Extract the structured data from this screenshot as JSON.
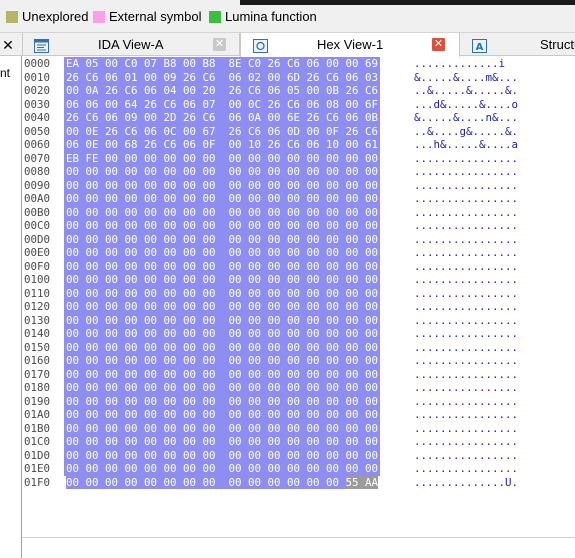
{
  "legend": [
    {
      "label": "Unexplored",
      "color": "#b5b569"
    },
    {
      "label": "External symbol",
      "color": "#ff9ee8"
    },
    {
      "label": "Lumina function",
      "color": "#3cc03c"
    }
  ],
  "left_panel": {
    "fragment": "nt",
    "close_glyph": "✕"
  },
  "tabs": [
    {
      "label": "IDA View-A",
      "active": false,
      "icon": "ida-view-icon",
      "close": "✕"
    },
    {
      "label": "Hex View-1",
      "active": true,
      "icon": "hex-view-icon",
      "close": "✕"
    },
    {
      "label": "Structu",
      "active": false,
      "icon": "structures-icon"
    }
  ],
  "hex_rows": [
    {
      "addr": "0000",
      "hex": "EA 05 00 C0 07 B8 00 B8  8E C0 26 C6 06 00 00 69",
      "ascii": ".............i"
    },
    {
      "addr": "0010",
      "hex": "26 C6 06 01 00 09 26 C6  06 02 00 6D 26 C6 06 03",
      "ascii": "&.....&....m&..."
    },
    {
      "addr": "0020",
      "hex": "00 0A 26 C6 06 04 00 20  26 C6 06 05 00 0B 26 C6",
      "ascii": "..&.....&.....&."
    },
    {
      "addr": "0030",
      "hex": "06 06 00 64 26 C6 06 07  00 0C 26 C6 06 08 00 6F",
      "ascii": "...d&.....&....o"
    },
    {
      "addr": "0040",
      "hex": "26 C6 06 09 00 2D 26 C6  06 0A 00 6E 26 C6 06 0B",
      "ascii": "&.....&....n&..."
    },
    {
      "addr": "0050",
      "hex": "00 0E 26 C6 06 0C 00 67  26 C6 06 0D 00 0F 26 C6",
      "ascii": "..&....g&.....&."
    },
    {
      "addr": "0060",
      "hex": "06 0E 00 68 26 C6 06 0F  00 10 26 C6 06 10 00 61",
      "ascii": "...h&.....&....a"
    },
    {
      "addr": "0070",
      "hex": "EB FE 00 00 00 00 00 00  00 00 00 00 00 00 00 00",
      "ascii": "................"
    },
    {
      "addr": "0080",
      "hex": "00 00 00 00 00 00 00 00  00 00 00 00 00 00 00 00",
      "ascii": "................"
    },
    {
      "addr": "0090",
      "hex": "00 00 00 00 00 00 00 00  00 00 00 00 00 00 00 00",
      "ascii": "................"
    },
    {
      "addr": "00A0",
      "hex": "00 00 00 00 00 00 00 00  00 00 00 00 00 00 00 00",
      "ascii": "................"
    },
    {
      "addr": "00B0",
      "hex": "00 00 00 00 00 00 00 00  00 00 00 00 00 00 00 00",
      "ascii": "................"
    },
    {
      "addr": "00C0",
      "hex": "00 00 00 00 00 00 00 00  00 00 00 00 00 00 00 00",
      "ascii": "................"
    },
    {
      "addr": "00D0",
      "hex": "00 00 00 00 00 00 00 00  00 00 00 00 00 00 00 00",
      "ascii": "................"
    },
    {
      "addr": "00E0",
      "hex": "00 00 00 00 00 00 00 00  00 00 00 00 00 00 00 00",
      "ascii": "................"
    },
    {
      "addr": "00F0",
      "hex": "00 00 00 00 00 00 00 00  00 00 00 00 00 00 00 00",
      "ascii": "................"
    },
    {
      "addr": "0100",
      "hex": "00 00 00 00 00 00 00 00  00 00 00 00 00 00 00 00",
      "ascii": "................"
    },
    {
      "addr": "0110",
      "hex": "00 00 00 00 00 00 00 00  00 00 00 00 00 00 00 00",
      "ascii": "................"
    },
    {
      "addr": "0120",
      "hex": "00 00 00 00 00 00 00 00  00 00 00 00 00 00 00 00",
      "ascii": "................"
    },
    {
      "addr": "0130",
      "hex": "00 00 00 00 00 00 00 00  00 00 00 00 00 00 00 00",
      "ascii": "................"
    },
    {
      "addr": "0140",
      "hex": "00 00 00 00 00 00 00 00  00 00 00 00 00 00 00 00",
      "ascii": "................"
    },
    {
      "addr": "0150",
      "hex": "00 00 00 00 00 00 00 00  00 00 00 00 00 00 00 00",
      "ascii": "................"
    },
    {
      "addr": "0160",
      "hex": "00 00 00 00 00 00 00 00  00 00 00 00 00 00 00 00",
      "ascii": "................"
    },
    {
      "addr": "0170",
      "hex": "00 00 00 00 00 00 00 00  00 00 00 00 00 00 00 00",
      "ascii": "................"
    },
    {
      "addr": "0180",
      "hex": "00 00 00 00 00 00 00 00  00 00 00 00 00 00 00 00",
      "ascii": "................"
    },
    {
      "addr": "0190",
      "hex": "00 00 00 00 00 00 00 00  00 00 00 00 00 00 00 00",
      "ascii": "................"
    },
    {
      "addr": "01A0",
      "hex": "00 00 00 00 00 00 00 00  00 00 00 00 00 00 00 00",
      "ascii": "................"
    },
    {
      "addr": "01B0",
      "hex": "00 00 00 00 00 00 00 00  00 00 00 00 00 00 00 00",
      "ascii": "................"
    },
    {
      "addr": "01C0",
      "hex": "00 00 00 00 00 00 00 00  00 00 00 00 00 00 00 00",
      "ascii": "................"
    },
    {
      "addr": "01D0",
      "hex": "00 00 00 00 00 00 00 00  00 00 00 00 00 00 00 00",
      "ascii": "................"
    },
    {
      "addr": "01E0",
      "hex": "00 00 00 00 00 00 00 00  00 00 00 00 00 00 00 00",
      "ascii": "................"
    },
    {
      "addr": "01F0",
      "hex": "00 00 00 00 00 00 00 00  00 00 00 00 00 00",
      "hex_tail": "55 AA",
      "ascii": "..............U."
    }
  ],
  "colors": {
    "selection": "#8e8ef2",
    "ascii_text": "#1d1dbb",
    "cursor_tail": "#9b9b9b"
  }
}
